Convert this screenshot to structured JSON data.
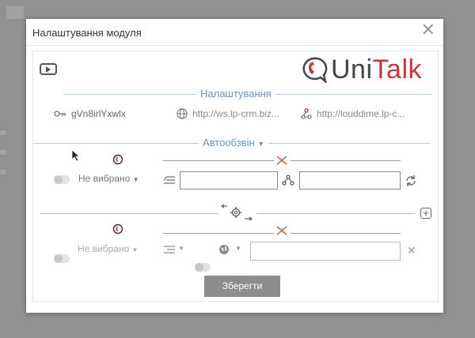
{
  "modal": {
    "title": "Налаштування модуля",
    "close_symbol": "✕"
  },
  "logo": {
    "part1": "Uni",
    "part2": "Talk"
  },
  "settings_section": {
    "title": "Налаштування",
    "key": "gVn8irlYxwlx",
    "url1": "http://ws.lp-crm.biz...",
    "url2": "http://louddime.lp-c..."
  },
  "autodial_section": {
    "title": "Автообзвін",
    "toggle_label": "Не вибрано",
    "input1_value": "",
    "input2_value": ""
  },
  "row2": {
    "toggle_label": "Не вибрано",
    "input_value": ""
  },
  "actions": {
    "save_label": "Зберегти"
  },
  "colors": {
    "accent": "#6c93b8",
    "brand_red": "#c63743",
    "save_button": "#8c8c8c"
  },
  "icons": [
    "youtube-icon",
    "key-icon",
    "globe-icon",
    "webhook-icon",
    "phone-icon",
    "cross-colored-icon",
    "list-icon",
    "branch-icon",
    "refresh-icon",
    "gear-arrows-icon",
    "plus-icon",
    "close-icon"
  ]
}
